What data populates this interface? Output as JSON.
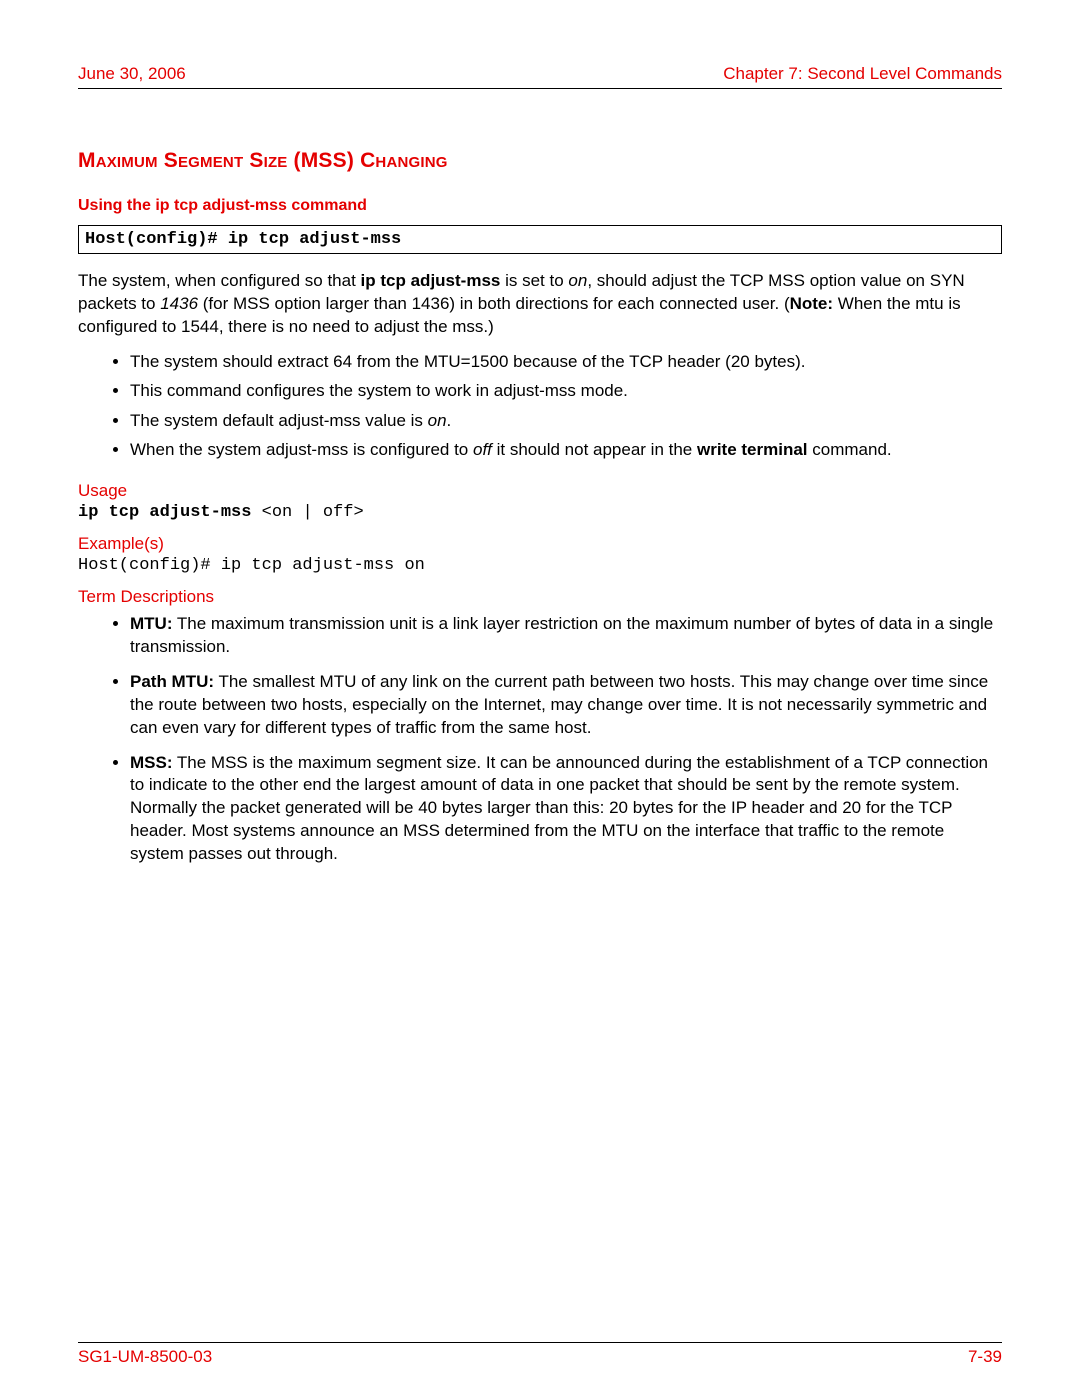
{
  "header": {
    "date": "June 30, 2006",
    "chapter": "Chapter 7: Second Level Commands"
  },
  "section": {
    "title": "Maximum Segment Size (MSS) Changing",
    "subtitle": "Using the ip tcp adjust-mss command",
    "codebox": "Host(config)# ip tcp adjust-mss"
  },
  "intro": {
    "p1a": "The system, when configured so that ",
    "p1b": "ip tcp adjust-mss",
    "p1c": " is set to ",
    "p1d": "on",
    "p1e": ", should adjust the TCP MSS option value on SYN packets to ",
    "p1f": "1436",
    "p1g": " (for MSS option larger than 1436) in both directions for each connected user. (",
    "p1h": "Note:",
    "p1i": " When the mtu is configured to 1544, there is no need to adjust the mss.)"
  },
  "bullets": {
    "b1": "The system should extract 64 from the MTU=1500 because of the TCP header (20 bytes).",
    "b2": "This command configures the system to work in adjust-mss mode.",
    "b3a": "The system default adjust-mss value is ",
    "b3b": "on",
    "b3c": ".",
    "b4a": "When the system adjust-mss is configured to ",
    "b4b": "off",
    "b4c": " it should not appear in the ",
    "b4d": "write terminal",
    "b4e": " command."
  },
  "usage": {
    "label": "Usage",
    "cmd_bold": "ip tcp adjust-mss ",
    "cmd_rest": "<on | off>"
  },
  "examples": {
    "label": "Example(s)",
    "text": "Host(config)# ip tcp adjust-mss on"
  },
  "terms": {
    "label": "Term Descriptions",
    "t1_name": "MTU:",
    "t1_body": " The maximum transmission unit is a link layer restriction on the maximum number of bytes of data in a single transmission.",
    "t2_name": "Path MTU:",
    "t2_body": " The smallest MTU of any link on the current path between two hosts. This may change over time since the route between two hosts, especially on the Internet, may change over time. It is not necessarily symmetric and can even vary for different types of traffic from the same host.",
    "t3_name": "MSS:",
    "t3_body": " The MSS is the maximum segment size. It can be announced during the establishment of a TCP connection to indicate to the other end the largest amount of data in one packet that should be sent by the remote system. Normally the packet generated will be 40 bytes larger than this: 20 bytes for the IP header and 20 for the TCP header. Most systems announce an MSS determined from the MTU on the interface that traffic to the remote system passes out through."
  },
  "footer": {
    "left": "SG1-UM-8500-03",
    "right": "7-39"
  }
}
